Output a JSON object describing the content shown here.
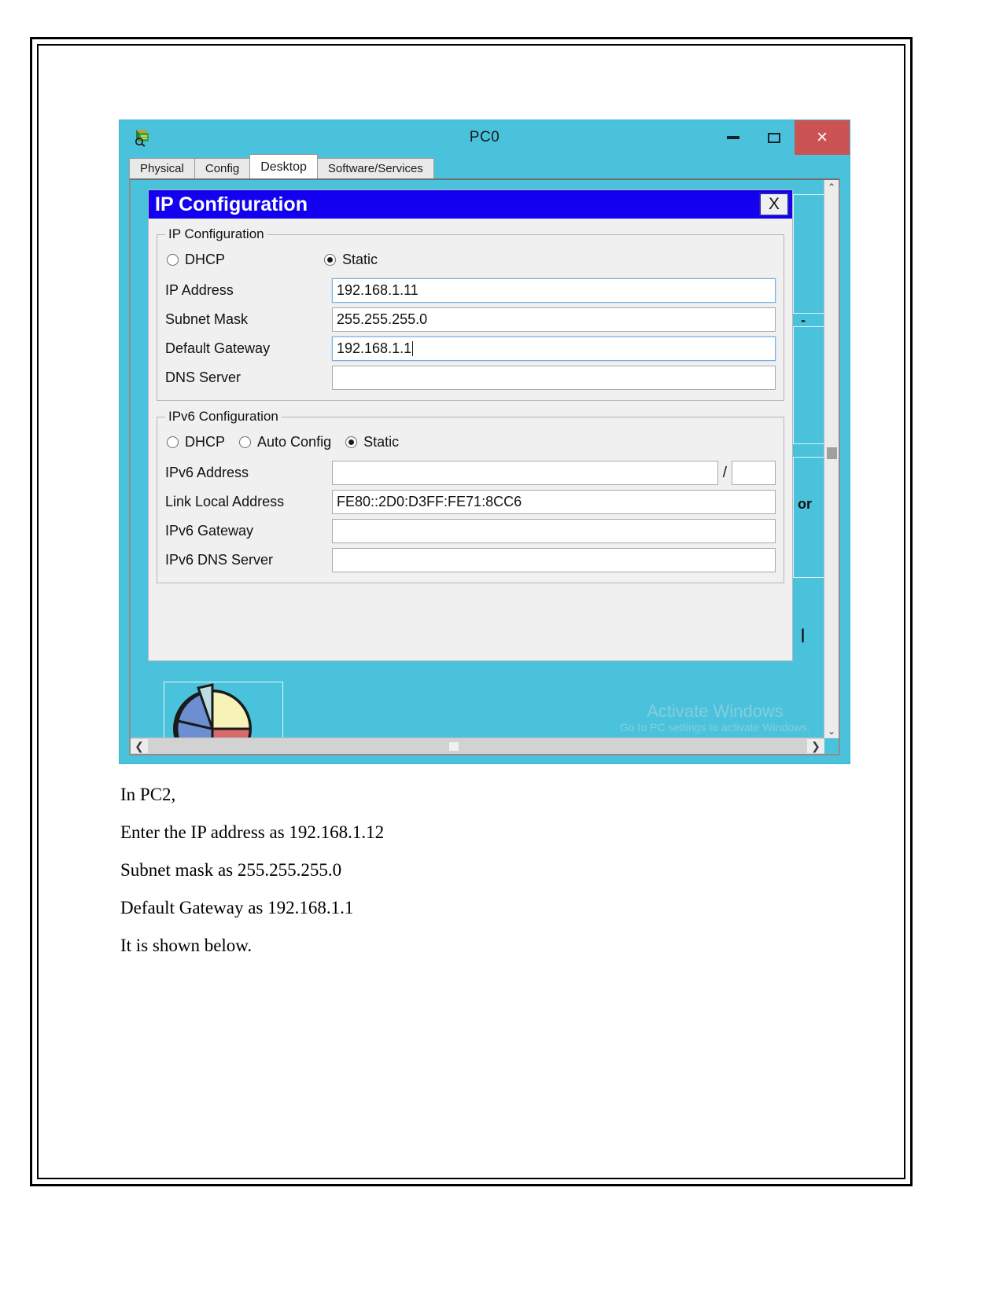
{
  "window": {
    "title": "PC0",
    "icon": "packet-tracer-device-icon",
    "controls": {
      "minimize": "–",
      "maximize": "▢",
      "close": "×"
    },
    "tabs": [
      {
        "label": "Physical",
        "active": false
      },
      {
        "label": "Config",
        "active": false
      },
      {
        "label": "Desktop",
        "active": true
      },
      {
        "label": "Software/Services",
        "active": false
      }
    ],
    "watermark": {
      "line1": "Activate Windows",
      "line2": "Go to PC settings to activate Windows."
    }
  },
  "dialog": {
    "title": "IP Configuration",
    "close_label": "X",
    "ipv4": {
      "legend": "IP Configuration",
      "modes": [
        {
          "label": "DHCP",
          "selected": false
        },
        {
          "label": "Static",
          "selected": true
        }
      ],
      "fields": [
        {
          "label": "IP Address",
          "value": "192.168.1.11",
          "focused": true,
          "caret": false
        },
        {
          "label": "Subnet Mask",
          "value": "255.255.255.0",
          "focused": false,
          "caret": false
        },
        {
          "label": "Default Gateway",
          "value": "192.168.1.1",
          "focused": true,
          "caret": true
        },
        {
          "label": "DNS Server",
          "value": "",
          "focused": false,
          "caret": false
        }
      ]
    },
    "ipv6": {
      "legend": "IPv6 Configuration",
      "modes": [
        {
          "label": "DHCP",
          "selected": false
        },
        {
          "label": "Auto Config",
          "selected": false
        },
        {
          "label": "Static",
          "selected": true
        }
      ],
      "address": {
        "label": "IPv6 Address",
        "value": "",
        "separator": "/",
        "prefix": ""
      },
      "fields": [
        {
          "label": "Link Local Address",
          "value": "FE80::2D0:D3FF:FE71:8CC6"
        },
        {
          "label": "IPv6 Gateway",
          "value": ""
        },
        {
          "label": "IPv6 DNS Server",
          "value": ""
        }
      ]
    }
  },
  "desktop_background": {
    "partial_labels": [
      "-",
      "or",
      "|"
    ],
    "icon": "pie-chart-icon"
  },
  "scrollbars": {
    "vertical": {
      "up": "⌃",
      "down": "⌄"
    },
    "horizontal": {
      "left": "❮",
      "right": "❯"
    }
  },
  "document": {
    "lines": [
      "In PC2,",
      "Enter the IP address as 192.168.1.12",
      "Subnet mask as 255.255.255.0",
      "Default Gateway as 192.168.1.1",
      "It is shown below."
    ]
  },
  "colors": {
    "window_chrome": "#4BC2DB",
    "dialog_title": "#1400F0",
    "close_button": "#CB5353",
    "dialog_bg": "#F0F0F0"
  }
}
